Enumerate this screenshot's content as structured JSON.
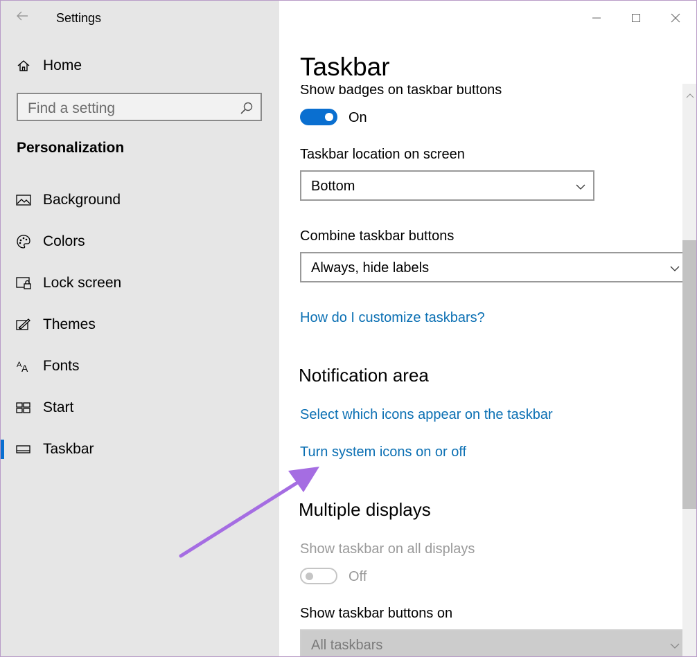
{
  "window": {
    "title": "Settings",
    "controls": [
      "back",
      "minimize",
      "maximize",
      "close"
    ]
  },
  "sidebar": {
    "home_label": "Home",
    "search_placeholder": "Find a setting",
    "category": "Personalization",
    "items": [
      {
        "label": "Background",
        "icon": "image-icon"
      },
      {
        "label": "Colors",
        "icon": "palette-icon"
      },
      {
        "label": "Lock screen",
        "icon": "lock-screen-icon"
      },
      {
        "label": "Themes",
        "icon": "themes-icon"
      },
      {
        "label": "Fonts",
        "icon": "fonts-icon"
      },
      {
        "label": "Start",
        "icon": "start-icon"
      },
      {
        "label": "Taskbar",
        "icon": "taskbar-icon",
        "selected": true
      }
    ],
    "accent_color": "#0a6fd0"
  },
  "main": {
    "page_title": "Taskbar",
    "badges_label": "Show badges on taskbar buttons",
    "badges_state": "On",
    "location_label": "Taskbar location on screen",
    "location_value": "Bottom",
    "combine_label": "Combine taskbar buttons",
    "combine_value": "Always, hide labels",
    "customize_link": "How do I customize taskbars?",
    "notification_heading": "Notification area",
    "select_icons_link": "Select which icons appear on the taskbar",
    "system_icons_link": "Turn system icons on or off",
    "multiple_heading": "Multiple displays",
    "show_all_label": "Show taskbar on all displays",
    "show_all_state": "Off",
    "buttons_on_label": "Show taskbar buttons on",
    "buttons_on_value": "All taskbars"
  },
  "annotation": {
    "arrow_color": "#a56de2"
  }
}
